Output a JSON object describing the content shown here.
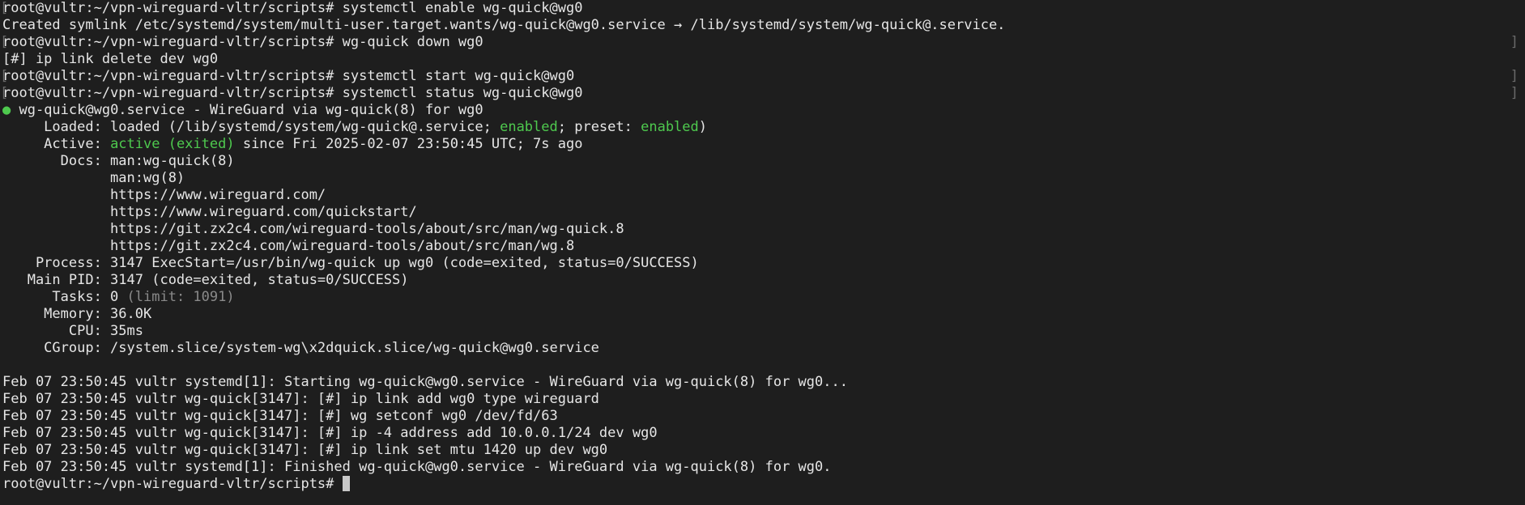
{
  "terminal": {
    "prompt": "root@vultr:~/vpn-wireguard-vltr/scripts# ",
    "lines": {
      "l01_cmd": "systemctl enable wg-quick@wg0",
      "l02": "Created symlink /etc/systemd/system/multi-user.target.wants/wg-quick@wg0.service → /lib/systemd/system/wg-quick@.service.",
      "l03_cmd": "wg-quick down wg0",
      "l04": "[#] ip link delete dev wg0",
      "l05_cmd": "systemctl start wg-quick@wg0",
      "l06_cmd": "systemctl status wg-quick@wg0",
      "l07_bullet": "●",
      "l07": " wg-quick@wg0.service - WireGuard via wg-quick(8) for wg0",
      "l08_a": "     Loaded: loaded (/lib/systemd/system/wg-quick@.service; ",
      "l08_enabled": "enabled",
      "l08_b": "; preset: ",
      "l08_preset": "enabled",
      "l08_c": ")",
      "l09_a": "     Active: ",
      "l09_active": "active (exited)",
      "l09_b": " since Fri 2025-02-07 23:50:45 UTC; 7s ago",
      "l10": "       Docs: man:wg-quick(8)",
      "l11": "             man:wg(8)",
      "l12": "             https://www.wireguard.com/",
      "l13": "             https://www.wireguard.com/quickstart/",
      "l14": "             https://git.zx2c4.com/wireguard-tools/about/src/man/wg-quick.8",
      "l15": "             https://git.zx2c4.com/wireguard-tools/about/src/man/wg.8",
      "l16": "    Process: 3147 ExecStart=/usr/bin/wg-quick up wg0 (code=exited, status=0/SUCCESS)",
      "l17": "   Main PID: 3147 (code=exited, status=0/SUCCESS)",
      "l18_a": "      Tasks: 0 ",
      "l18_dim": "(limit: 1091)",
      "l19": "     Memory: 36.0K",
      "l20": "        CPU: 35ms",
      "l21": "     CGroup: /system.slice/system-wg\\x2dquick.slice/wg-quick@wg0.service",
      "l23": "Feb 07 23:50:45 vultr systemd[1]: Starting wg-quick@wg0.service - WireGuard via wg-quick(8) for wg0...",
      "l24": "Feb 07 23:50:45 vultr wg-quick[3147]: [#] ip link add wg0 type wireguard",
      "l25": "Feb 07 23:50:45 vultr wg-quick[3147]: [#] wg setconf wg0 /dev/fd/63",
      "l26": "Feb 07 23:50:45 vultr wg-quick[3147]: [#] ip -4 address add 10.0.0.1/24 dev wg0",
      "l27": "Feb 07 23:50:45 vultr wg-quick[3147]: [#] ip link set mtu 1420 up dev wg0",
      "l28": "Feb 07 23:50:45 vultr systemd[1]: Finished wg-quick@wg0.service - WireGuard via wg-quick(8) for wg0."
    },
    "colors": {
      "background": "#1e1e1e",
      "foreground": "#e6e6e6",
      "green": "#4ec94e",
      "dim": "#8a8a8a"
    }
  }
}
